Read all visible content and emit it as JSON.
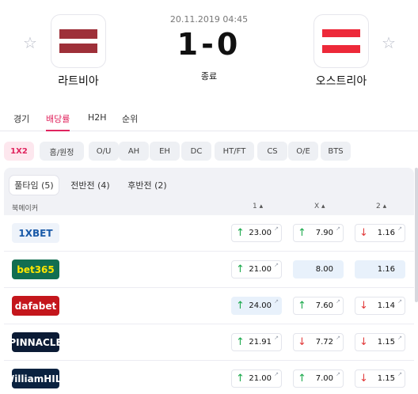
{
  "match": {
    "datetime": "20.11.2019 04:45",
    "score": "1-0",
    "status": "종료",
    "home": {
      "name": "라트비아",
      "flag_colors": [
        "#9e3039",
        "#ffffff",
        "#9e3039"
      ]
    },
    "away": {
      "name": "오스트리아",
      "flag_colors": [
        "#ed2939",
        "#ffffff",
        "#ed2939"
      ]
    }
  },
  "tabs": [
    "경기",
    "배당률",
    "H2H",
    "순위"
  ],
  "active_tab": "배당률",
  "markets": [
    "1X2",
    "홈/원정",
    "O/U",
    "AH",
    "EH",
    "DC",
    "HT/FT",
    "CS",
    "O/E",
    "BTS"
  ],
  "active_market": "1X2",
  "periods": [
    "풀타임 (5)",
    "전반전 (4)",
    "후반전 (2)"
  ],
  "active_period": "풀타임 (5)",
  "columns": {
    "bookmaker": "북메이커",
    "home": "1 ▴",
    "draw": "X ▴",
    "away": "2 ▴"
  },
  "bookmakers": [
    {
      "name": "1XBET",
      "logo_bg": "#eef3fa",
      "logo_fg": "#1a5aa8",
      "home": {
        "value": "23.00",
        "trend": "up"
      },
      "draw": {
        "value": "7.90",
        "trend": "up"
      },
      "away": {
        "value": "1.16",
        "trend": "down"
      },
      "highlight": ""
    },
    {
      "name": "bet365",
      "logo_bg": "#126e51",
      "logo_fg": "#ffe600",
      "home": {
        "value": "21.00",
        "trend": "up"
      },
      "draw": {
        "value": "8.00",
        "trend": ""
      },
      "away": {
        "value": "1.16",
        "trend": ""
      },
      "highlight": "draw,away"
    },
    {
      "name": "dafabet",
      "logo_bg": "#c4161c",
      "logo_fg": "#ffffff",
      "home": {
        "value": "24.00",
        "trend": "up"
      },
      "draw": {
        "value": "7.60",
        "trend": "up"
      },
      "away": {
        "value": "1.14",
        "trend": "down"
      },
      "highlight": "home"
    },
    {
      "name": "PINNACLE",
      "logo_bg": "#0b1b35",
      "logo_fg": "#ffffff",
      "home": {
        "value": "21.91",
        "trend": "up"
      },
      "draw": {
        "value": "7.72",
        "trend": "down"
      },
      "away": {
        "value": "1.15",
        "trend": "down"
      },
      "highlight": ""
    },
    {
      "name": "WilliamHILL",
      "logo_bg": "#0a2240",
      "logo_fg": "#ffffff",
      "home": {
        "value": "21.00",
        "trend": "up"
      },
      "draw": {
        "value": "7.00",
        "trend": "up"
      },
      "away": {
        "value": "1.15",
        "trend": "down"
      },
      "highlight": ""
    }
  ]
}
